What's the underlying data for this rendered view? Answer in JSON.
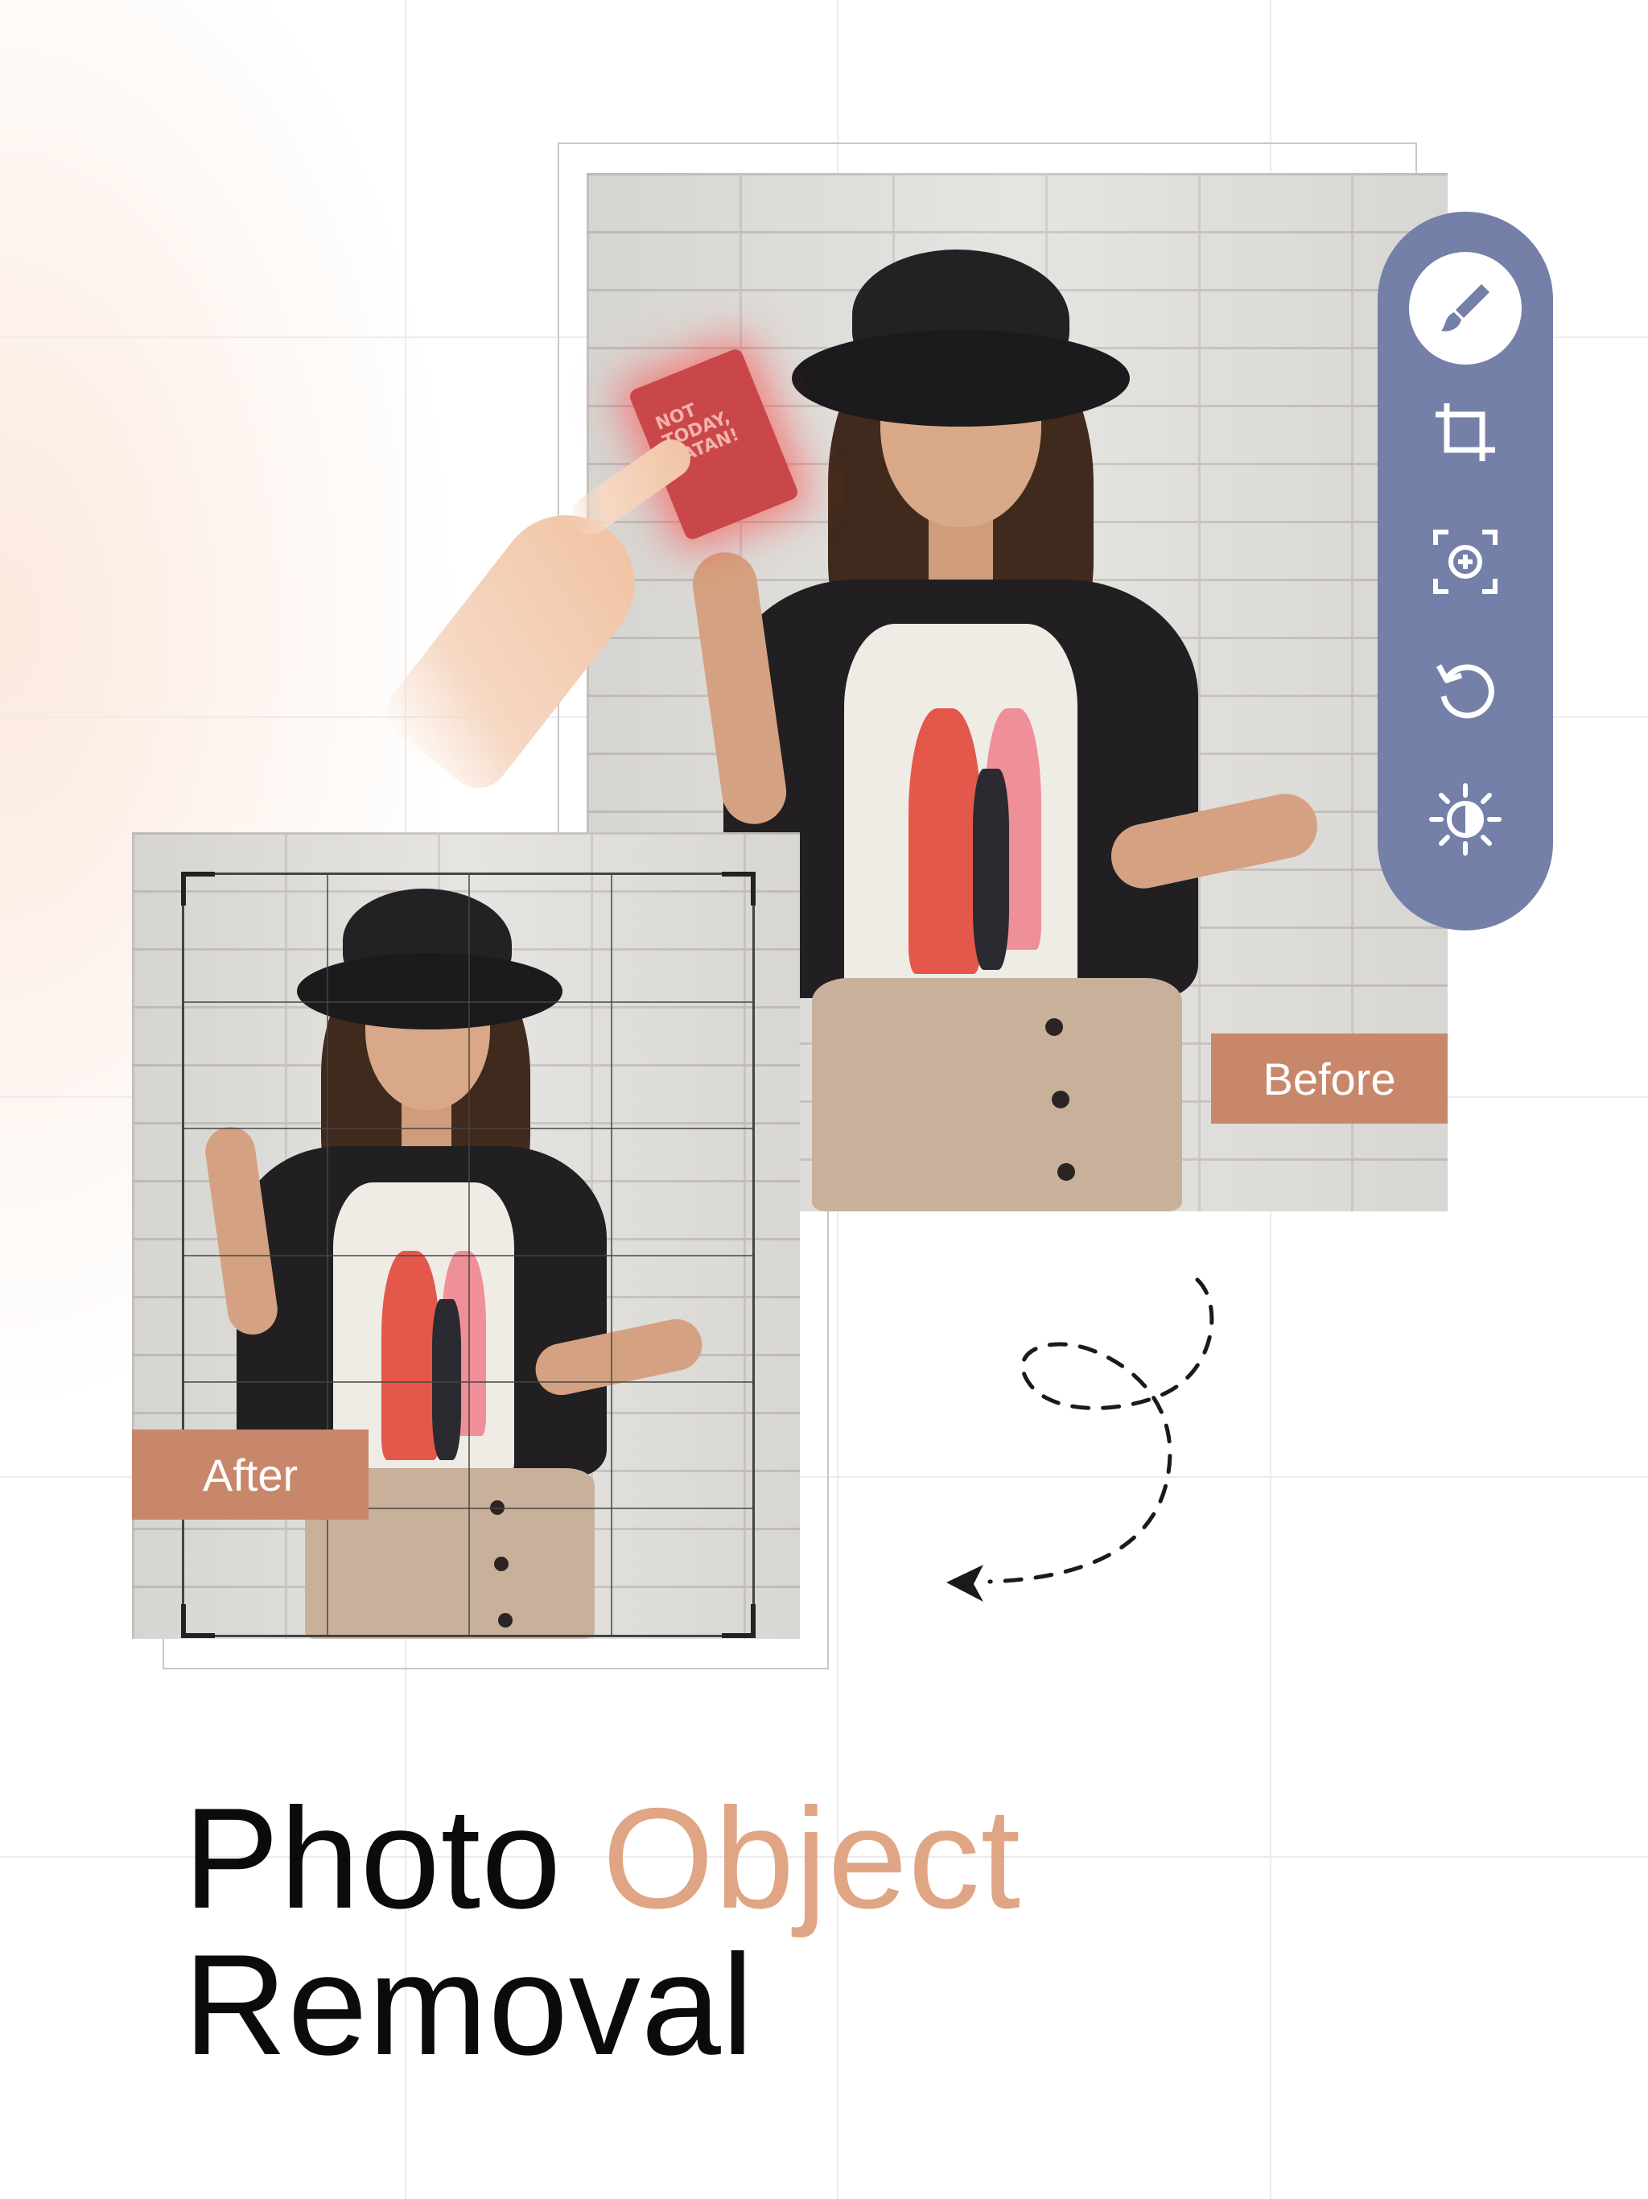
{
  "before_label": "Before",
  "after_label": "After",
  "book_text": "NOT TODAY, SATAN!",
  "headline": {
    "word1": "Photo",
    "word2": "Object",
    "line2": "Removal"
  },
  "colors": {
    "accent": "#e0a584",
    "tag": "#c8876a",
    "toolbar": "#7480a8"
  },
  "toolbar": {
    "tools": [
      "brush-icon",
      "crop-icon",
      "focus-add-icon",
      "rotate-icon",
      "brightness-icon"
    ],
    "active_tool": "brush-icon"
  }
}
